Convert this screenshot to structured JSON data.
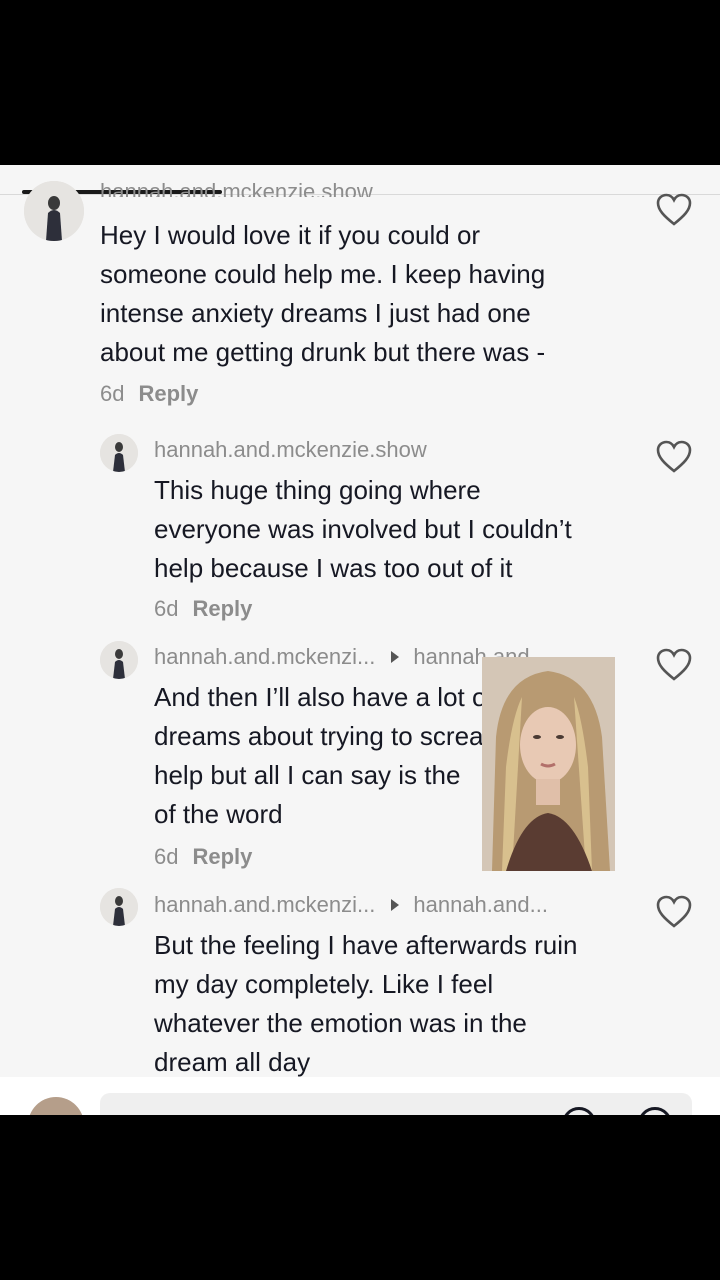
{
  "comments": [
    {
      "username": "hannah.and.mckenzie.show",
      "text_lines": [
        "Hey I would love it if you could or",
        "someone could help me. I keep having",
        "intense anxiety dreams I just had one",
        "about me getting drunk but there was -"
      ],
      "time": "6d",
      "reply_label": "Reply"
    },
    {
      "username": "hannah.and.mckenzie.show",
      "text_lines": [
        "This huge thing going where",
        "everyone was involved but I couldn’t",
        "help because I was too out of it"
      ],
      "time": "6d",
      "reply_label": "Reply"
    },
    {
      "username": "hannah.and.mckenzi...",
      "reply_to": "hannah.and...",
      "text_lines": [
        "And then I’ll also have a lot of",
        "dreams about trying to scream for",
        "help but all I can say is the",
        "of the word"
      ],
      "time": "6d",
      "reply_label": "Reply"
    },
    {
      "username": "hannah.and.mckenzi...",
      "reply_to": "hannah.and...",
      "text_lines": [
        "But the feeling I have afterwards ruin",
        "my day completely. Like I feel",
        "whatever the emotion was in the",
        "dream all day"
      ]
    }
  ],
  "icons": {
    "like": "heart-outline-icon",
    "reply_arrow": "triangle-right-icon"
  },
  "colors": {
    "text": "#161823",
    "muted": "#8c8c8c",
    "background": "#f6f6f6"
  }
}
